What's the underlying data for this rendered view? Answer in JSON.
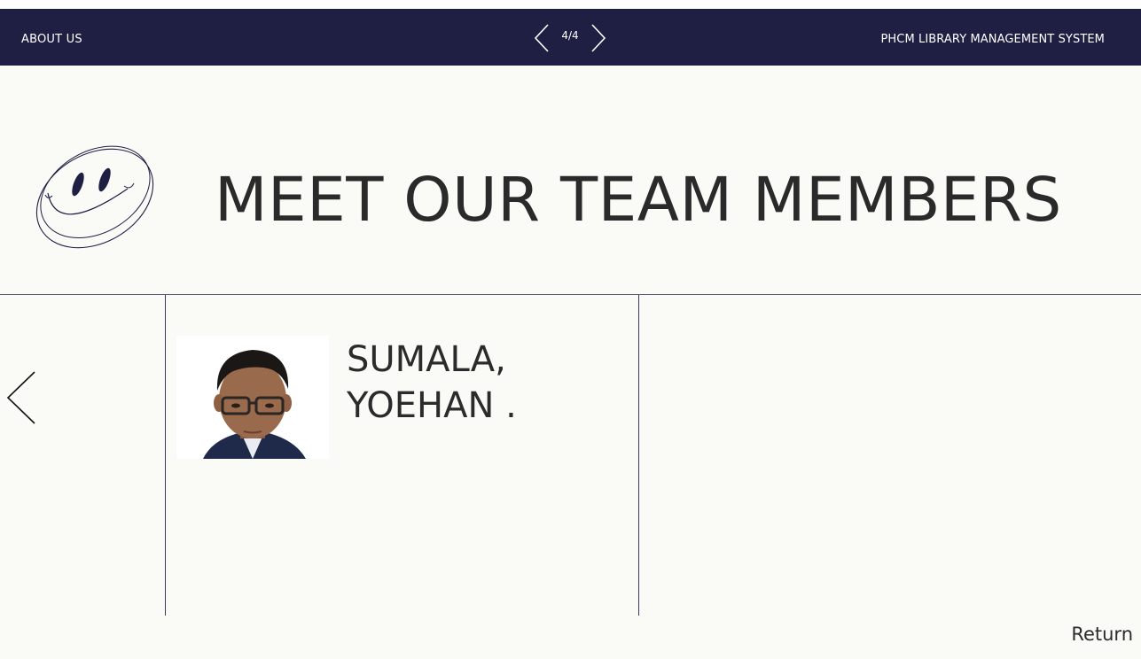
{
  "header": {
    "about_label": "ABOUT  US",
    "page_indicator": "4/4",
    "brand": "PHCM LIBRARY MANAGEMENT SYSTEM"
  },
  "main": {
    "title": "MEET OUR TEAM MEMBERS",
    "member": {
      "name_line1": "SUMALA,",
      "name_line2": "YOEHAN ."
    }
  },
  "footer": {
    "return_label": "Return"
  },
  "colors": {
    "header_bg": "#1f1f44",
    "page_bg": "#fafaf7",
    "text": "#2b2b2b"
  },
  "icons": [
    "chevron-left-icon",
    "chevron-right-icon",
    "smiley-icon",
    "back-arrow-icon"
  ]
}
